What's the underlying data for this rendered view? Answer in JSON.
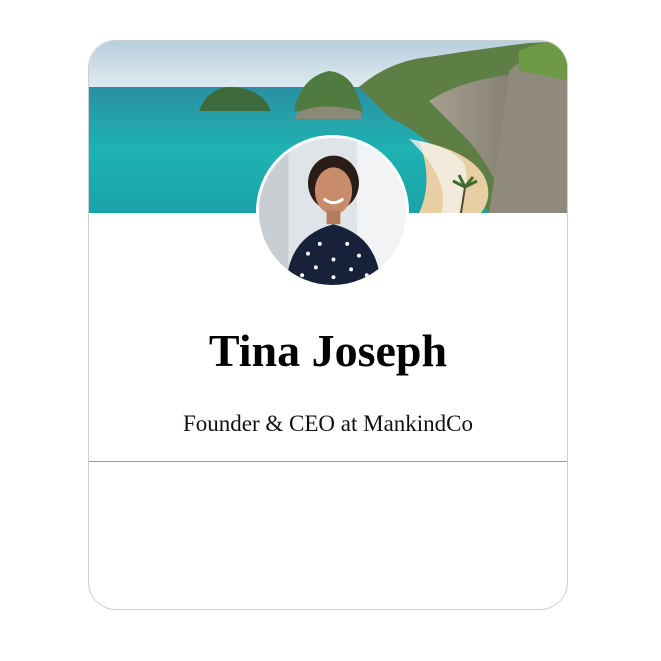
{
  "profile_card": {
    "cover_image": "beach-cover-photo",
    "avatar_image": "profile-photo",
    "name": "Tina Joseph",
    "title": "Founder & CEO at MankindCo"
  },
  "colors": {
    "card_border": "#cfcfcf",
    "divider": "#999999",
    "name_text": "#000000",
    "sea": "#1fa6ad",
    "sand": "#e8cfa3",
    "cliff": "#8b8676"
  }
}
